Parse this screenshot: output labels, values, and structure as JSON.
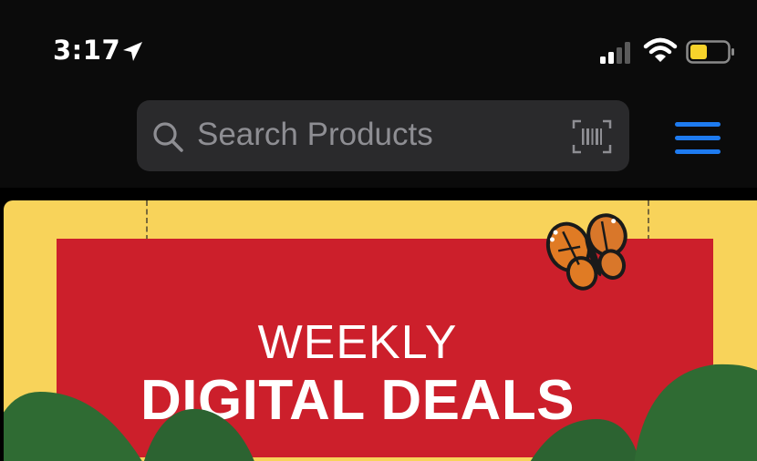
{
  "status_bar": {
    "time": "3:17"
  },
  "search": {
    "placeholder": "Search Products"
  },
  "banner": {
    "line1": "WEEKLY",
    "line2": "DIGITAL DEALS"
  },
  "colors": {
    "accent": "#1e7bf0",
    "banner_yellow": "#f8d35a",
    "banner_red": "#cc1f2b",
    "leaf_green": "#2f6b33"
  },
  "icons": {
    "location": "location-arrow-icon",
    "signal": "cellular-signal-icon",
    "wifi": "wifi-icon",
    "battery": "battery-icon",
    "search": "search-icon",
    "barcode": "barcode-scan-icon",
    "menu": "hamburger-menu-icon",
    "butterfly": "butterfly-icon"
  }
}
